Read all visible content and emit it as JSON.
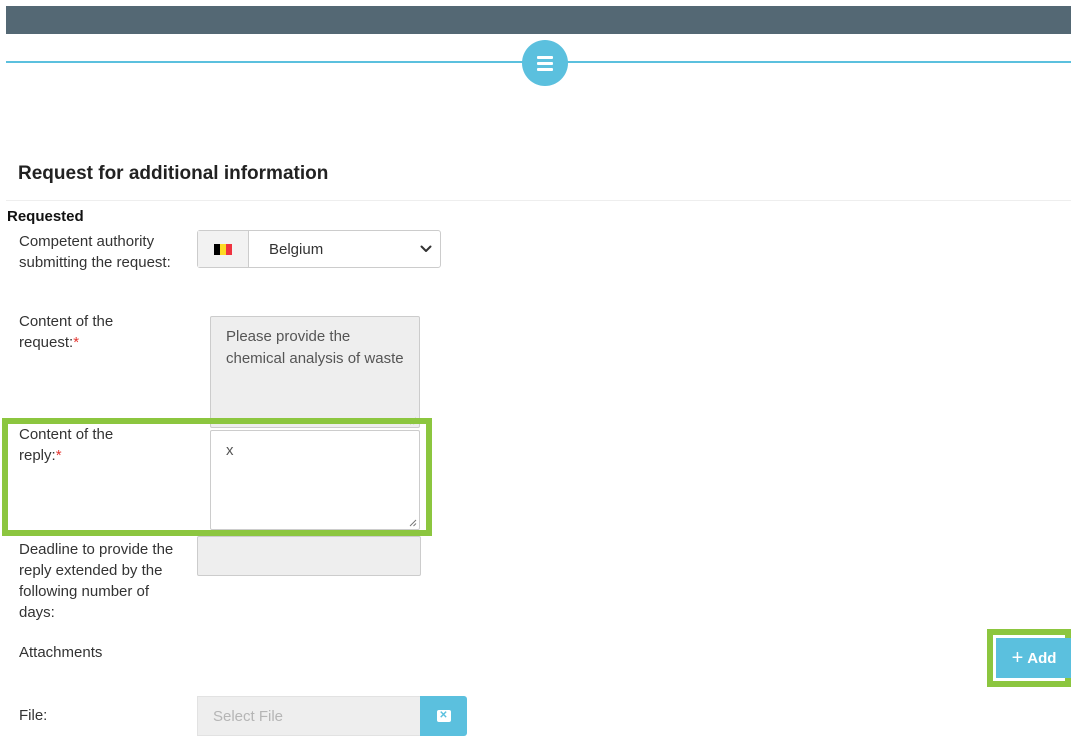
{
  "header": {
    "menu_icon": "hamburger-icon"
  },
  "page": {
    "title": "Request for additional information"
  },
  "section": {
    "label": "Requested"
  },
  "fields": {
    "authority": {
      "label": "Competent authority submitting the request:",
      "value": "Belgium",
      "flag_icon": "belgium-flag-icon",
      "flag_colors": [
        "#000000",
        "#fdda24",
        "#ef3340"
      ]
    },
    "request_content": {
      "label": "Content of the request:",
      "required_mark": "*",
      "value": "Please provide the chemical analysis of waste"
    },
    "reply_content": {
      "label": "Content of the reply:",
      "required_mark": "*",
      "value": "x"
    },
    "deadline": {
      "label": "Deadline to provide the reply extended by the following number of days:",
      "value": ""
    },
    "attachments": {
      "label": "Attachments",
      "add_label": "Add",
      "add_icon": "plus-icon"
    },
    "file": {
      "label": "File:",
      "placeholder": "Select File",
      "clear_icon": "clear-file-icon"
    }
  },
  "colors": {
    "topbar": "#546874",
    "accent": "#5bc0de",
    "highlight": "#8cc63f",
    "required": "#e3342f",
    "readonly_bg": "#eeeeee"
  }
}
